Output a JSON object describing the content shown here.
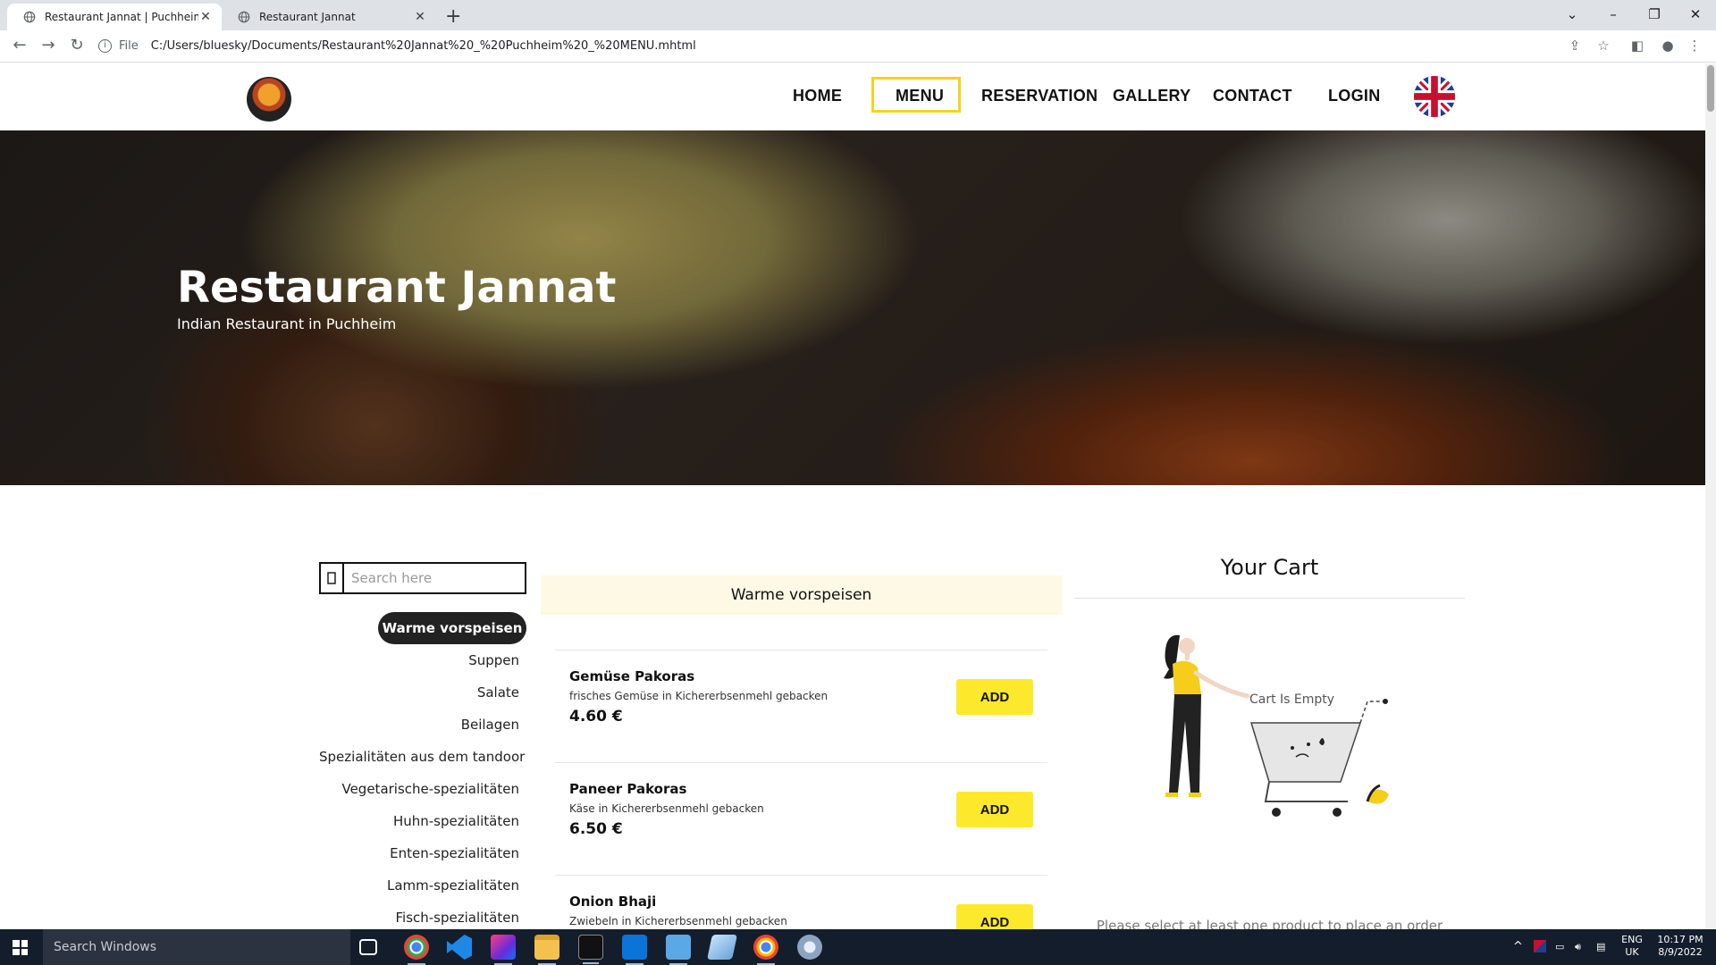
{
  "browser": {
    "tabs": [
      {
        "title": "Restaurant Jannat | Puchheim | M",
        "active": true
      },
      {
        "title": "Restaurant Jannat",
        "active": false
      }
    ],
    "address_prefix": "File",
    "url": "C:/Users/bluesky/Documents/Restaurant%20Jannat%20_%20Puchheim%20_%20MENU.mhtml"
  },
  "nav": {
    "links": [
      "HOME",
      "MENU",
      "RESERVATION",
      "GALLERY",
      "CONTACT",
      "LOGIN"
    ],
    "active": "MENU"
  },
  "hero": {
    "title": "Restaurant Jannat",
    "subtitle": "Indian Restaurant in Puchheim"
  },
  "search": {
    "placeholder": "Search here"
  },
  "categories": [
    "Warme vorspeisen",
    "Suppen",
    "Salate",
    "Beilagen",
    "Spezialitäten aus dem tandoor",
    "Vegetarische-spezialitäten",
    "Huhn-spezialitäten",
    "Enten-spezialitäten",
    "Lamm-spezialitäten",
    "Fisch-spezialitäten"
  ],
  "menu": {
    "section": "Warme vorspeisen",
    "items": [
      {
        "name": "Gemüse Pakoras",
        "desc": "frisches Gemüse in Kichererbsenmehl gebacken",
        "price": "4.60 €",
        "button": "ADD"
      },
      {
        "name": "Paneer Pakoras",
        "desc": "Käse in Kichererbsenmehl gebacken",
        "price": "6.50 €",
        "button": "ADD"
      },
      {
        "name": "Onion Bhaji",
        "desc": "Zwiebeln in Kichererbsenmehl gebacken",
        "price": "",
        "button": "ADD"
      }
    ]
  },
  "cart": {
    "title": "Your Cart",
    "empty_label": "Cart Is Empty",
    "note": "Please select at least one product to place an order"
  },
  "taskbar": {
    "search_placeholder": "Search Windows",
    "lang_top": "ENG",
    "lang_bottom": "UK",
    "time": "10:17 PM",
    "date": "8/9/2022"
  }
}
